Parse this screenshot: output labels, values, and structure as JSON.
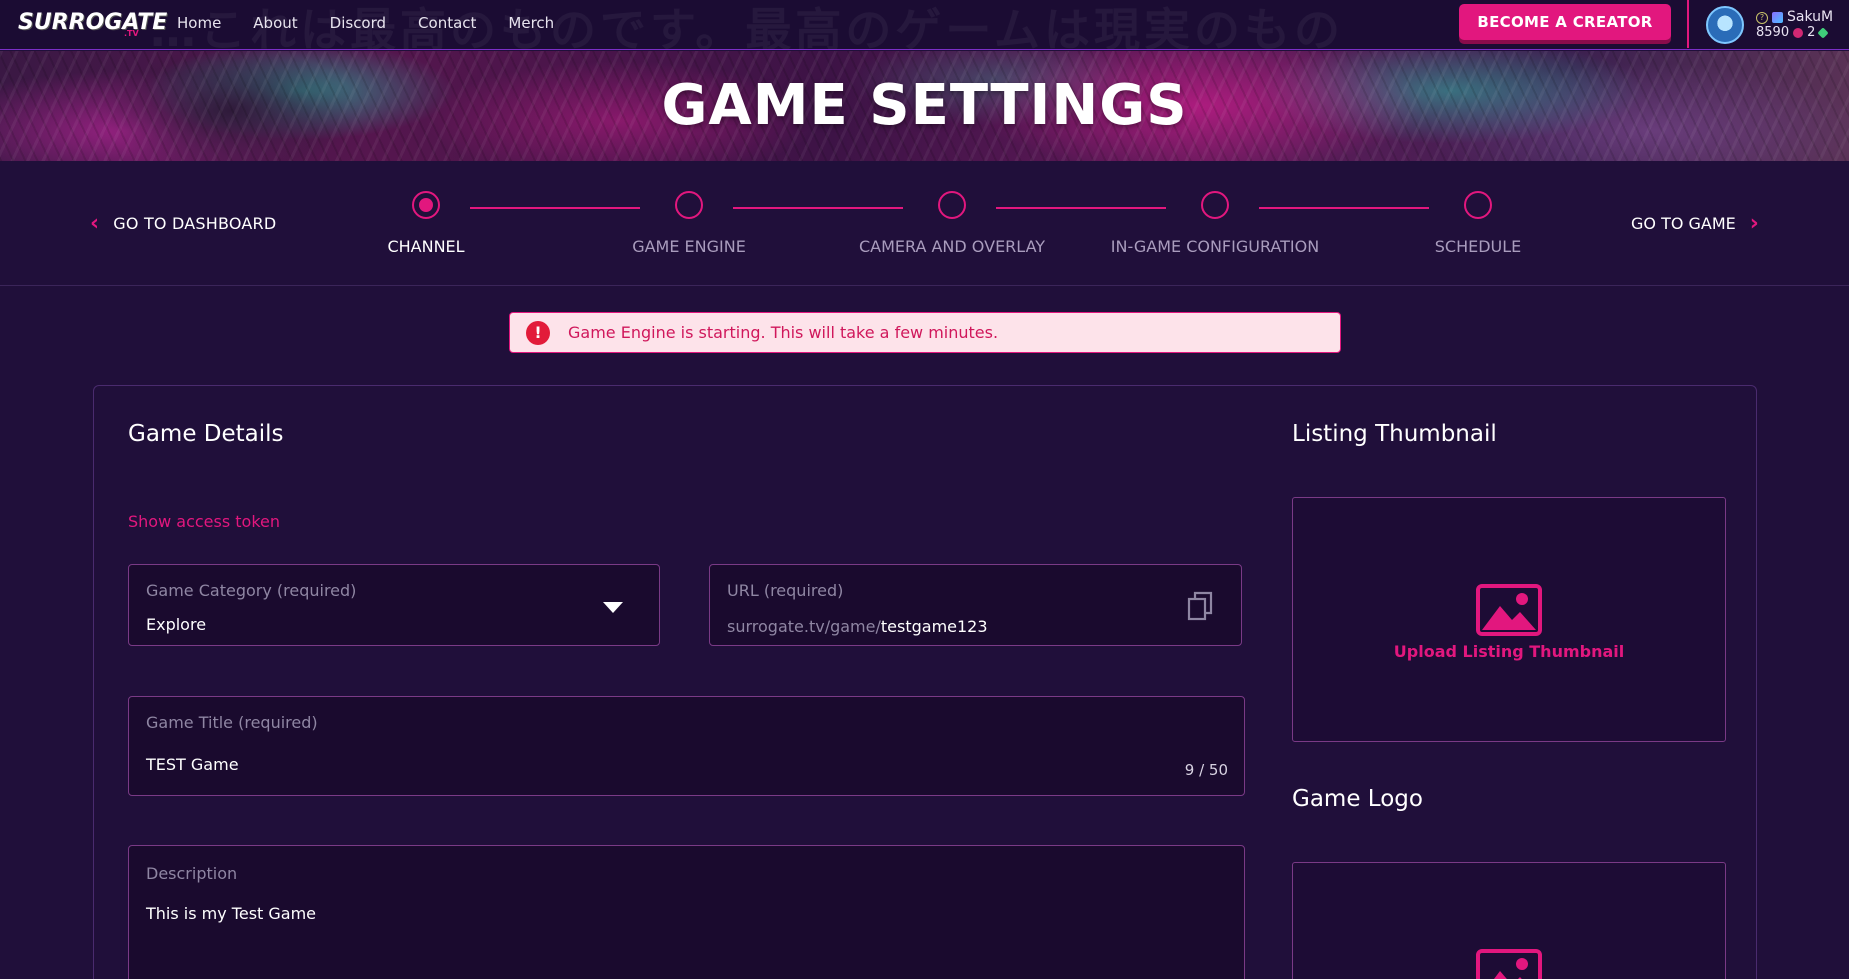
{
  "nav": {
    "logo": "SURROGATE",
    "logo_sub": ".TV",
    "bg_text": "…これは最高のものです。最高のゲームは現実のもの",
    "links": [
      "Home",
      "About",
      "Discord",
      "Contact",
      "Merch"
    ],
    "creator_button": "BECOME A CREATOR",
    "user": {
      "name": "SakuM",
      "coins": "8590",
      "gems": "2"
    }
  },
  "banner": {
    "title": "GAME SETTINGS"
  },
  "stepper": {
    "back_label": "GO TO DASHBOARD",
    "forward_label": "GO TO GAME",
    "steps": [
      "CHANNEL",
      "GAME ENGINE",
      "CAMERA AND OVERLAY",
      "IN-GAME CONFIGURATION",
      "SCHEDULE"
    ],
    "active_index": 0
  },
  "alert": {
    "text": "Game Engine is starting. This will take a few minutes."
  },
  "details": {
    "heading": "Game Details",
    "token_link": "Show access token",
    "category": {
      "label": "Game Category (required)",
      "value": "Explore"
    },
    "url": {
      "label": "URL (required)",
      "prefix": "surrogate.tv/game/",
      "value": "testgame123"
    },
    "title": {
      "label": "Game Title (required)",
      "value": "TEST Game",
      "counter": "9 / 50"
    },
    "description": {
      "label": "Description",
      "value": "This is my Test Game"
    }
  },
  "thumbnail": {
    "heading": "Listing Thumbnail",
    "upload_label": "Upload Listing Thumbnail"
  },
  "logo_section": {
    "heading": "Game Logo"
  },
  "colors": {
    "accent": "#e2177e",
    "background": "#200f3a",
    "alert_bg": "#fde3ea"
  }
}
